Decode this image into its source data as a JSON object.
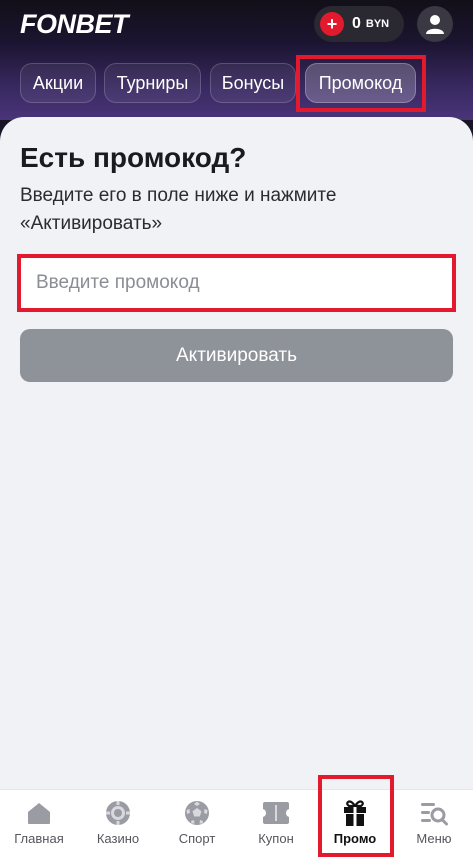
{
  "header": {
    "logo": "FONBET",
    "balance_amount": "0",
    "balance_currency": "BYN"
  },
  "tabs": [
    {
      "label": "Акции"
    },
    {
      "label": "Турниры"
    },
    {
      "label": "Бонусы"
    },
    {
      "label": "Промокод",
      "active": true
    }
  ],
  "promo": {
    "title": "Есть промокод?",
    "description": "Введите его в поле ниже и нажмите «Активировать»",
    "input_placeholder": "Введите промокод",
    "input_value": "",
    "activate_label": "Активировать"
  },
  "bottom_nav": [
    {
      "label": "Главная",
      "icon": "home-icon"
    },
    {
      "label": "Казино",
      "icon": "casino-chip-icon"
    },
    {
      "label": "Спорт",
      "icon": "soccer-ball-icon"
    },
    {
      "label": "Купон",
      "icon": "coupon-ticket-icon"
    },
    {
      "label": "Промо",
      "icon": "gift-icon",
      "active": true
    },
    {
      "label": "Меню",
      "icon": "menu-search-icon"
    }
  ],
  "colors": {
    "accent_red": "#e3192d",
    "button_disabled": "#8e9299",
    "panel_bg": "#f1f2f6"
  }
}
